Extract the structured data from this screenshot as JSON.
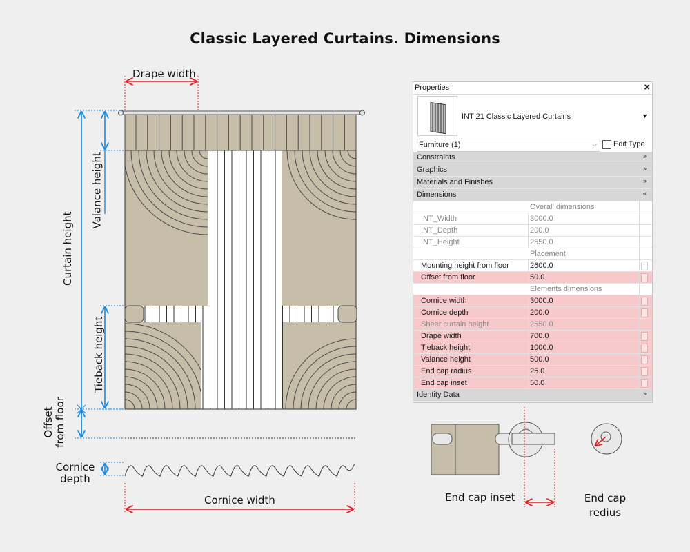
{
  "title": "Classic Layered Curtains. Dimensions",
  "labels": {
    "drape_width": "Drape width",
    "valance_height": "Valance height",
    "curtain_height": "Curtain height",
    "tieback_height": "Tieback height",
    "offset_from_floor_line1": "Offset",
    "offset_from_floor_line2": "from floor",
    "cornice_depth_line1": "Cornice",
    "cornice_depth_line2": "depth",
    "cornice_width": "Cornice width",
    "end_cap_inset": "End cap inset",
    "end_cap_radius_line1": "End cap",
    "end_cap_radius_line2": "redius"
  },
  "colors": {
    "background": "#efefef",
    "fabric": "#c7bea9",
    "dimension_blue": "#1a8ae0",
    "dimension_red": "#e01f25",
    "highlight_row": "#f7c9cb"
  },
  "properties": {
    "header": "Properties",
    "close_icon": "close-icon",
    "type_name": "INT 21 Classic Layered Curtains",
    "filter": "Furniture (1)",
    "edit_type": "Edit Type",
    "categories": {
      "constraints": "Constraints",
      "graphics": "Graphics",
      "materials": "Materials and Finishes",
      "dimensions": "Dimensions",
      "identity": "Identity Data"
    },
    "groups": {
      "overall": "Overall dimensions",
      "placement": "Placement",
      "elements": "Elements dimensions"
    },
    "rows": {
      "int_width": {
        "name": "INT_Width",
        "value": "3000.0",
        "greyed": true,
        "highlighted": false
      },
      "int_depth": {
        "name": "INT_Depth",
        "value": "200.0",
        "greyed": true,
        "highlighted": false
      },
      "int_height": {
        "name": "INT_Height",
        "value": "2550.0",
        "greyed": true,
        "highlighted": false
      },
      "mounting_height": {
        "name": "Mounting height from floor",
        "value": "2600.0",
        "greyed": false,
        "highlighted": false
      },
      "offset_floor": {
        "name": "Offset from floor",
        "value": "50.0",
        "greyed": false,
        "highlighted": true
      },
      "cornice_width": {
        "name": "Cornice width",
        "value": "3000.0",
        "greyed": false,
        "highlighted": true
      },
      "cornice_depth": {
        "name": "Cornice depth",
        "value": "200.0",
        "greyed": false,
        "highlighted": true
      },
      "sheer_height": {
        "name": "Sheer curtain height",
        "value": "2550.0",
        "greyed": true,
        "highlighted": true
      },
      "drape_width": {
        "name": "Drape width",
        "value": "700.0",
        "greyed": false,
        "highlighted": true
      },
      "tieback_height": {
        "name": "Tieback height",
        "value": "1000.0",
        "greyed": false,
        "highlighted": true
      },
      "valance_height": {
        "name": "Valance height",
        "value": "500.0",
        "greyed": false,
        "highlighted": true
      },
      "end_cap_radius": {
        "name": "End cap radius",
        "value": "25.0",
        "greyed": false,
        "highlighted": true
      },
      "end_cap_inset": {
        "name": "End cap inset",
        "value": "50.0",
        "greyed": false,
        "highlighted": true
      }
    }
  }
}
